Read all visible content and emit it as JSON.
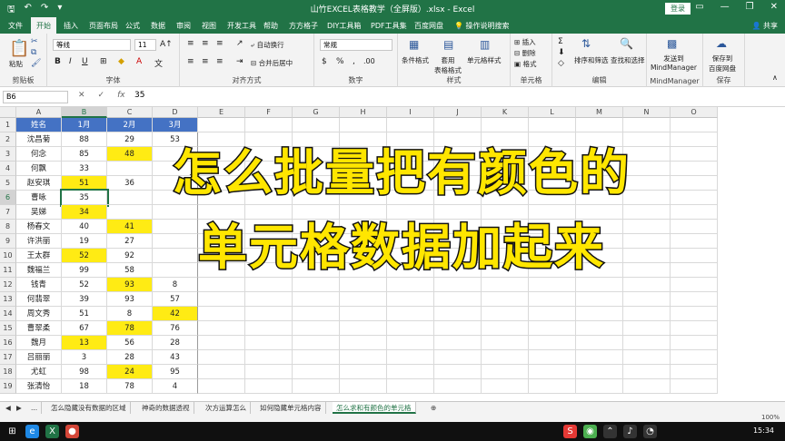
{
  "titlebar": {
    "title": "山竹EXCEL表格教学（全屏版）.xlsx  -  Excel",
    "login": "登录",
    "qa_icons": [
      "save-icon",
      "undo-icon",
      "redo-icon",
      "customize-icon"
    ]
  },
  "tabs": {
    "items": [
      "文件",
      "开始",
      "插入",
      "页面布局",
      "公式",
      "数据",
      "审阅",
      "视图",
      "开发工具",
      "帮助",
      "方方格子",
      "DIY工具箱",
      "PDF工具集",
      "百度网盘",
      "操作说明搜索"
    ],
    "active": "开始",
    "share": "共享"
  },
  "ribbon": {
    "clipboard": {
      "paste": "粘贴",
      "label": "剪贴板"
    },
    "font": {
      "name": "等线",
      "size": "11",
      "label": "字体"
    },
    "alignment": {
      "wrap": "自动换行",
      "merge": "合并后居中",
      "label": "对齐方式"
    },
    "number": {
      "format": "常规",
      "label": "数字"
    },
    "styles": {
      "cond": "条件格式",
      "table": "套用\n表格格式",
      "cell": "单元格样式",
      "label": "样式"
    },
    "cells": {
      "insert": "插入",
      "delete": "删除",
      "format": "格式",
      "label": "单元格"
    },
    "editing": {
      "sort": "排序和筛选",
      "find": "查找和选择",
      "label": "编辑"
    },
    "mindmanager": {
      "send": "发送到\nMindManager",
      "label": "MindManager"
    },
    "save": {
      "baidu": "保存到\n百度网盘",
      "label": "保存"
    }
  },
  "formula": {
    "namebox": "B6",
    "value": "35"
  },
  "columns": [
    "A",
    "B",
    "C",
    "D",
    "E",
    "F",
    "G",
    "H",
    "I",
    "J",
    "K",
    "L",
    "M",
    "N",
    "O"
  ],
  "rows": [
    "1",
    "2",
    "3",
    "4",
    "5",
    "6",
    "7",
    "8",
    "9",
    "10",
    "11",
    "12",
    "13",
    "14",
    "15",
    "16",
    "17",
    "18",
    "19"
  ],
  "table": {
    "headers": [
      "姓名",
      "1月",
      "2月",
      "3月"
    ],
    "rows": [
      {
        "name": "沈昌菊",
        "b": "88",
        "c": "29",
        "d": "53",
        "hl": []
      },
      {
        "name": "何念",
        "b": "85",
        "c": "48",
        "d": "",
        "hl": [
          "c"
        ]
      },
      {
        "name": "何飘",
        "b": "33",
        "c": "",
        "d": "",
        "hl": []
      },
      {
        "name": "赵安琪",
        "b": "51",
        "c": "36",
        "d": "",
        "hl": [
          "b"
        ]
      },
      {
        "name": "曹咏",
        "b": "35",
        "c": "",
        "d": "",
        "hl": []
      },
      {
        "name": "吴娣",
        "b": "34",
        "c": "",
        "d": "",
        "hl": [
          "b"
        ]
      },
      {
        "name": "杨春文",
        "b": "40",
        "c": "41",
        "d": "",
        "hl": [
          "c"
        ]
      },
      {
        "name": "许洪丽",
        "b": "19",
        "c": "27",
        "d": "",
        "hl": []
      },
      {
        "name": "王太群",
        "b": "52",
        "c": "92",
        "d": "",
        "hl": [
          "b"
        ]
      },
      {
        "name": "魏福兰",
        "b": "99",
        "c": "58",
        "d": "",
        "hl": []
      },
      {
        "name": "钱青",
        "b": "52",
        "c": "93",
        "d": "8",
        "hl": [
          "c"
        ]
      },
      {
        "name": "何翡翠",
        "b": "39",
        "c": "93",
        "d": "57",
        "hl": []
      },
      {
        "name": "周文秀",
        "b": "51",
        "c": "8",
        "d": "42",
        "hl": [
          "d"
        ]
      },
      {
        "name": "曹翠柔",
        "b": "67",
        "c": "78",
        "d": "76",
        "hl": [
          "c"
        ]
      },
      {
        "name": "魏月",
        "b": "13",
        "c": "56",
        "d": "28",
        "hl": [
          "b"
        ]
      },
      {
        "name": "吕丽丽",
        "b": "3",
        "c": "28",
        "d": "43",
        "hl": []
      },
      {
        "name": "尤虹",
        "b": "98",
        "c": "24",
        "d": "95",
        "hl": [
          "c"
        ]
      },
      {
        "name": "张清怡",
        "b": "18",
        "c": "78",
        "d": "4",
        "hl": []
      }
    ]
  },
  "overlay": {
    "line1": "怎么批量把有颜色的",
    "line2": "单元格数据加起来"
  },
  "sheets": [
    "...",
    "怎么隐藏没有数据的区域",
    "神奇的数据透视",
    "次方运算怎么",
    "如何隐藏单元格内容",
    "怎么求和有颜色的单元格"
  ],
  "active_sheet": "怎么求和有颜色的单元格",
  "status": {
    "zoom": "100%"
  },
  "taskbar": {
    "clock": "15:34"
  }
}
